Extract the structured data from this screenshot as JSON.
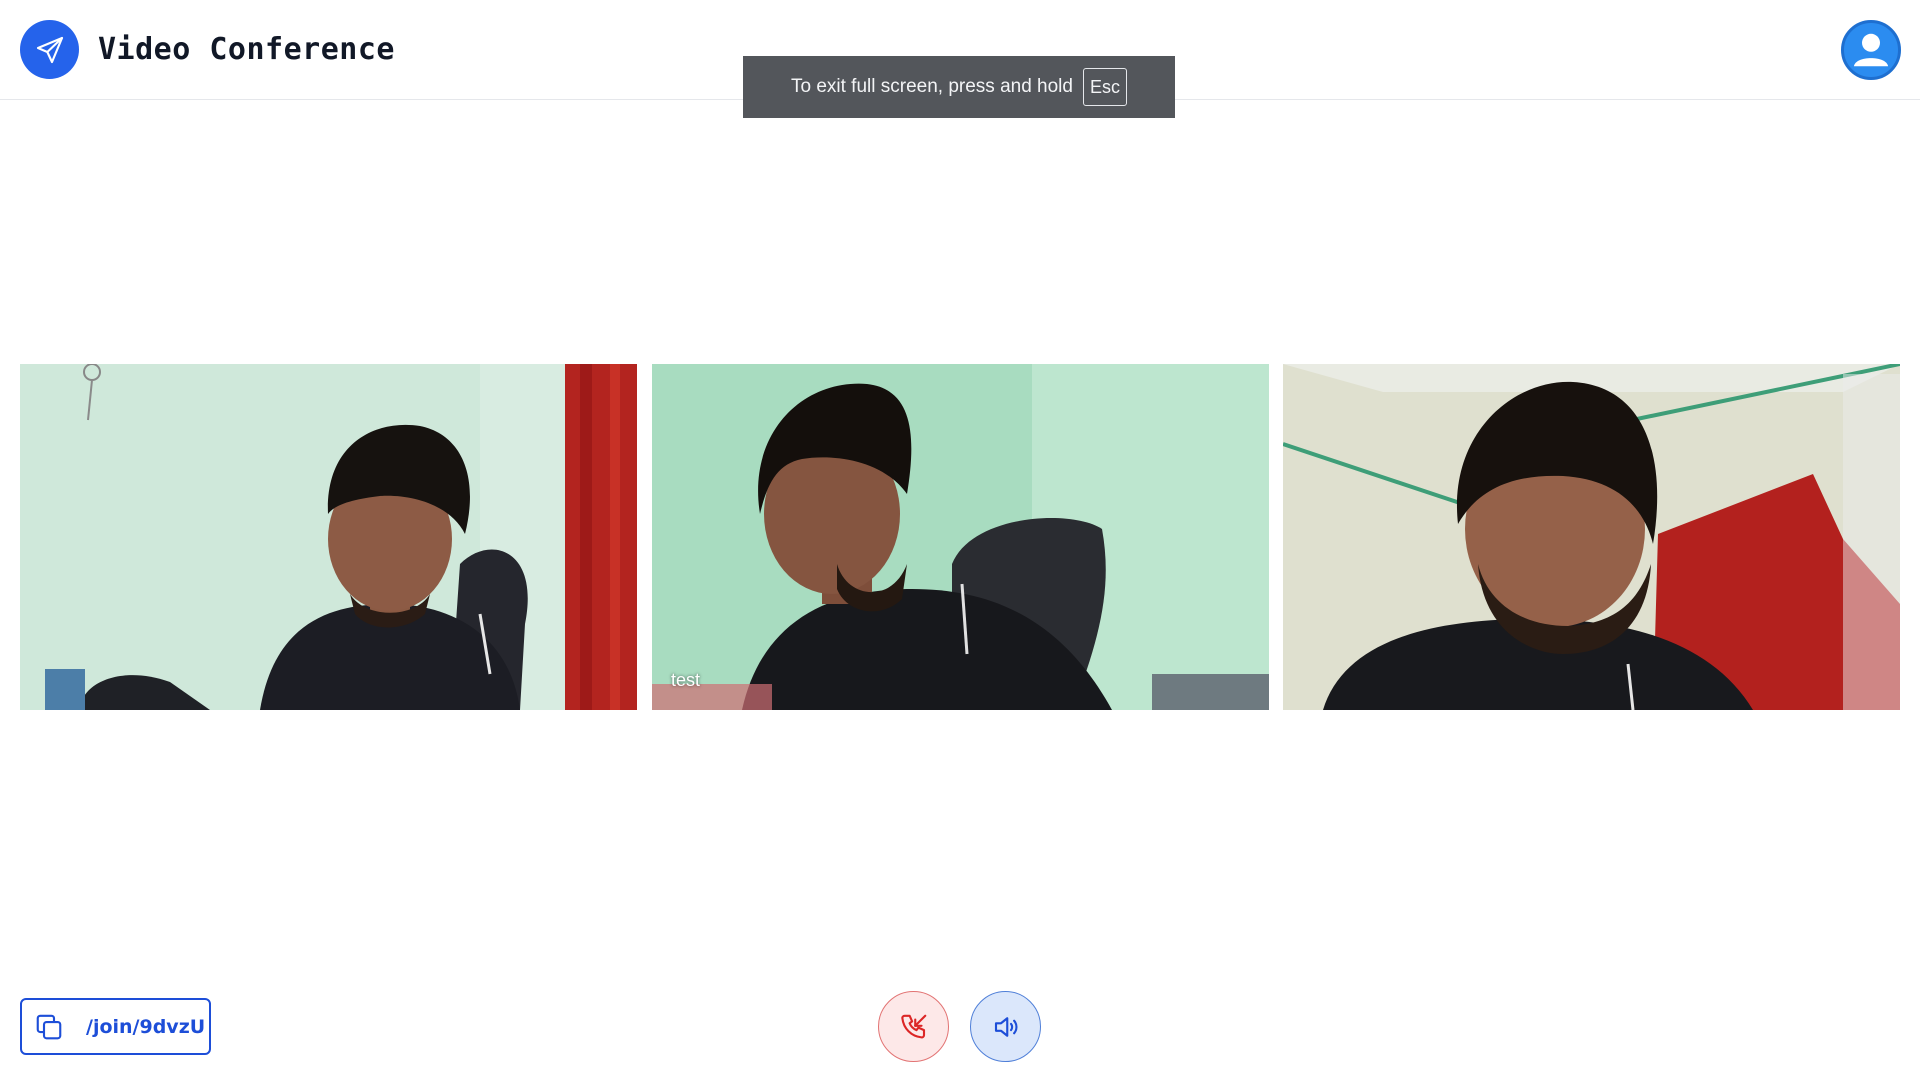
{
  "header": {
    "app_title": "Video Conference",
    "logo_icon": "paper-plane-icon",
    "avatar_icon": "user-icon"
  },
  "fullscreen_toast": {
    "message": "To exit full screen, press and hold",
    "key": "Esc"
  },
  "participants": [
    {
      "label": ""
    },
    {
      "label": "test"
    },
    {
      "label": ""
    }
  ],
  "controls": {
    "join_link": "/join/9dvzU",
    "copy_icon": "copy-icon",
    "end_call_icon": "phone-off-icon",
    "speaker_icon": "speaker-icon"
  },
  "colors": {
    "brand": "#2563eb",
    "end_call": "#dc2626",
    "speaker": "#1d4ed8"
  }
}
